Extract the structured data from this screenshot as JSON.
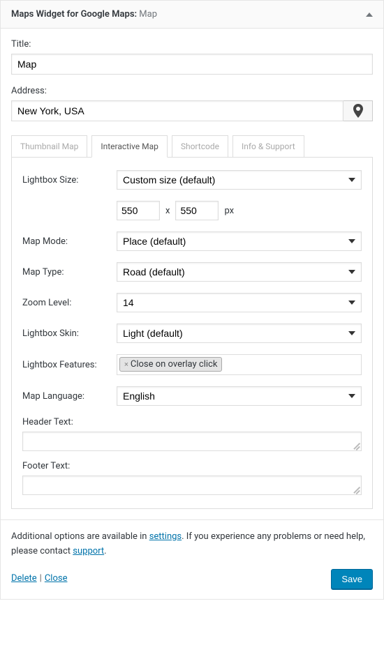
{
  "header": {
    "title_prefix": "Maps Widget for Google Maps:",
    "title_suffix": " Map"
  },
  "fields": {
    "title_label": "Title:",
    "title_value": "Map",
    "address_label": "Address:",
    "address_value": "New York, USA"
  },
  "tabs": [
    "Thumbnail Map",
    "Interactive Map",
    "Shortcode",
    "Info & Support"
  ],
  "panel": {
    "lightbox_size_label": "Lightbox Size:",
    "lightbox_size_value": "Custom size (default)",
    "size_w": "550",
    "size_x": "x",
    "size_h": "550",
    "size_unit": "px",
    "map_mode_label": "Map Mode:",
    "map_mode_value": "Place (default)",
    "map_type_label": "Map Type:",
    "map_type_value": "Road (default)",
    "zoom_label": "Zoom Level:",
    "zoom_value": "14",
    "skin_label": "Lightbox Skin:",
    "skin_value": "Light (default)",
    "features_label": "Lightbox Features:",
    "features_tag": "Close on overlay click",
    "lang_label": "Map Language:",
    "lang_value": "English",
    "header_text_label": "Header Text:",
    "footer_text_label": "Footer Text:"
  },
  "footer": {
    "text1": "Additional options are available in ",
    "settings_link": "settings",
    "text2": ". If you experience any problems or need help, please contact ",
    "support_link": "support",
    "text3": ".",
    "delete": "Delete",
    "close": "Close",
    "save": "Save"
  }
}
